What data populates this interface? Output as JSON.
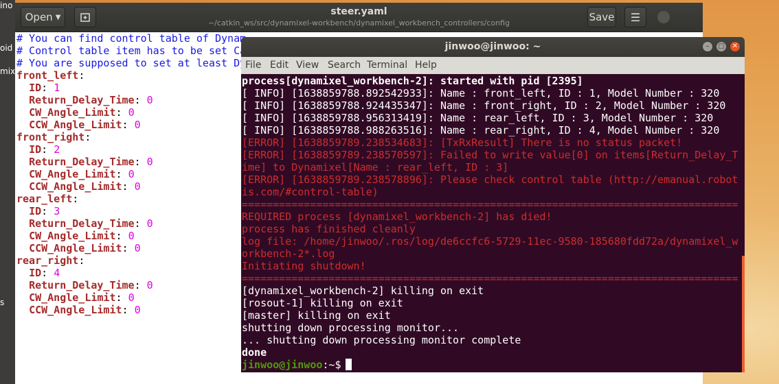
{
  "desktop": {
    "left_text": [
      "ino",
      "oid",
      "mix",
      "s"
    ]
  },
  "gedit": {
    "open_label": "Open",
    "title": "steer.yaml",
    "path": "~/catkin_ws/src/dynamixel-workbench/dynamixel_workbench_controllers/config",
    "save_label": "Save",
    "menu_icon": "hamburger-icon",
    "lines": [
      {
        "t": "comment",
        "text": "# You can find control table of Dynam"
      },
      {
        "t": "comment",
        "text": "# Control table item has to be set Ca"
      },
      {
        "t": "comment",
        "text": "# You are supposed to set at least Dy"
      },
      {
        "t": "section",
        "key": "front_left"
      },
      {
        "t": "kv",
        "key": "ID",
        "val": "1"
      },
      {
        "t": "kv",
        "key": "Return_Delay_Time",
        "val": "0"
      },
      {
        "t": "kv",
        "key": "CW_Angle_Limit",
        "val": "0"
      },
      {
        "t": "kv",
        "key": "CCW_Angle_Limit",
        "val": "0"
      },
      {
        "t": "section",
        "key": "front_right"
      },
      {
        "t": "kv",
        "key": "ID",
        "val": "2"
      },
      {
        "t": "kv",
        "key": "Return_Delay_Time",
        "val": "0"
      },
      {
        "t": "kv",
        "key": "CW_Angle_Limit",
        "val": "0"
      },
      {
        "t": "kv",
        "key": "CCW_Angle_Limit",
        "val": "0"
      },
      {
        "t": "section",
        "key": "rear_left"
      },
      {
        "t": "kv",
        "key": "ID",
        "val": "3"
      },
      {
        "t": "kv",
        "key": "Return_Delay_Time",
        "val": "0"
      },
      {
        "t": "kv",
        "key": "CW_Angle_Limit",
        "val": "0"
      },
      {
        "t": "kv",
        "key": "CCW_Angle_Limit",
        "val": "0"
      },
      {
        "t": "section",
        "key": "rear_right"
      },
      {
        "t": "kv",
        "key": "ID",
        "val": "4"
      },
      {
        "t": "kv",
        "key": "Return_Delay_Time",
        "val": "0"
      },
      {
        "t": "kv",
        "key": "CW_Angle_Limit",
        "val": "0"
      },
      {
        "t": "kv",
        "key": "CCW_Angle_Limit",
        "val": "0"
      }
    ]
  },
  "terminal": {
    "title": "jinwoo@jinwoo: ~",
    "menu": [
      "File",
      "Edit",
      "View",
      "Search",
      "Terminal",
      "Help"
    ],
    "colors": {
      "background": "#300a24",
      "error": "#cd2d2d",
      "prompt": "#4e9a06",
      "scrollbar": "#e96233"
    },
    "lines": [
      {
        "c": "white bold",
        "text": "process[dynamixel_workbench-2]: started with pid [2395]"
      },
      {
        "c": "white",
        "text": "[ INFO] [1638859788.892542933]: Name : front_left, ID : 1, Model Number : 320"
      },
      {
        "c": "white",
        "text": "[ INFO] [1638859788.924435347]: Name : front_right, ID : 2, Model Number : 320"
      },
      {
        "c": "white",
        "text": "[ INFO] [1638859788.956313419]: Name : rear_left, ID : 3, Model Number : 320"
      },
      {
        "c": "white",
        "text": "[ INFO] [1638859788.988263516]: Name : rear_right, ID : 4, Model Number : 320"
      },
      {
        "c": "red",
        "text": "[ERROR] [1638859789.238534683]: [TxRxResult] There is no status packet!"
      },
      {
        "c": "red",
        "text": "[ERROR] [1638859789.238570597]: Failed to write value[0] on items[Return_Delay_T"
      },
      {
        "c": "red",
        "text": "ime] to Dynamixel[Name : rear_left, ID : 3]"
      },
      {
        "c": "red",
        "text": "[ERROR] [1638859789.238578896]: Please check control table (http://emanual.robot"
      },
      {
        "c": "red",
        "text": "is.com/#control-table)"
      },
      {
        "c": "red",
        "text": "================================================================================"
      },
      {
        "c": "red",
        "text": "REQUIRED process [dynamixel_workbench-2] has died!"
      },
      {
        "c": "red",
        "text": "process has finished cleanly"
      },
      {
        "c": "red",
        "text": "log file: /home/jinwoo/.ros/log/de6ccfc6-5729-11ec-9580-185680fdd72a/dynamixel_w"
      },
      {
        "c": "red",
        "text": "orkbench-2*.log"
      },
      {
        "c": "red",
        "text": "Initiating shutdown!"
      },
      {
        "c": "red",
        "text": "================================================================================"
      },
      {
        "c": "white",
        "text": "[dynamixel_workbench-2] killing on exit"
      },
      {
        "c": "white",
        "text": "[rosout-1] killing on exit"
      },
      {
        "c": "white",
        "text": "[master] killing on exit"
      },
      {
        "c": "white",
        "text": "shutting down processing monitor..."
      },
      {
        "c": "white",
        "text": "... shutting down processing monitor complete"
      },
      {
        "c": "white bold",
        "text": "done"
      }
    ],
    "prompt_user": "jinwoo@jinwoo",
    "prompt_path": ":~$"
  }
}
